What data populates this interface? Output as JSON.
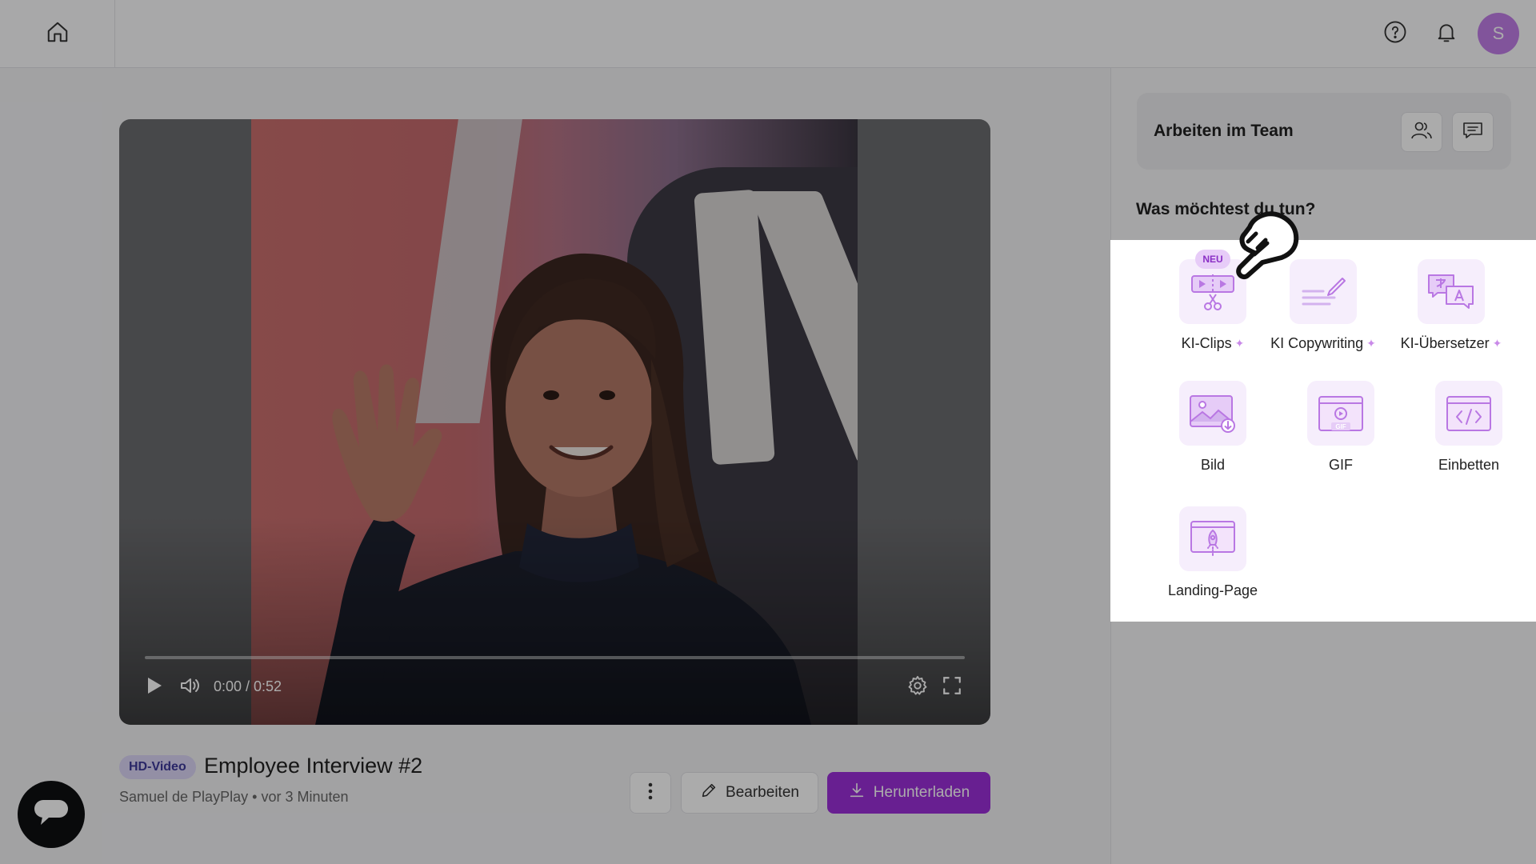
{
  "topbar": {
    "home_icon": "home-icon",
    "help_icon": "help-circle-icon",
    "bell_icon": "bell-icon",
    "avatar_initial": "S",
    "avatar_color": "#c17ee8"
  },
  "player": {
    "time": "0:00 / 0:52",
    "progress": 0,
    "icons": [
      "play-icon",
      "volume-icon",
      "settings-gear-icon",
      "fullscreen-icon"
    ]
  },
  "video": {
    "badge": "HD-Video",
    "title": "Employee Interview #2",
    "author": "Samuel de PlayPlay",
    "separator": "•",
    "time_ago": "vor 3 Minuten"
  },
  "buttons": {
    "edit_label": "Bearbeiten",
    "download_label": "Herunterladen",
    "accent": "#9b2fd9"
  },
  "team": {
    "title": "Arbeiten im Team"
  },
  "actions": {
    "question": "Was möchtest du tun?",
    "new_badge": "NEU",
    "items": [
      {
        "label": "KI-Clips",
        "icon": "clips-scissors-icon",
        "ai": true
      },
      {
        "label": "KI Copywriting",
        "icon": "pencil-lines-icon",
        "ai": true
      },
      {
        "label": "KI-Übersetzer",
        "icon": "translate-icon",
        "ai": true
      },
      {
        "label": "Bild",
        "icon": "image-download-icon",
        "ai": false
      },
      {
        "label": "GIF",
        "icon": "gif-icon",
        "ai": false
      },
      {
        "label": "Einbetten",
        "icon": "embed-code-icon",
        "ai": false
      },
      {
        "label": "Landing-Page",
        "icon": "rocket-page-icon",
        "ai": false
      }
    ]
  }
}
